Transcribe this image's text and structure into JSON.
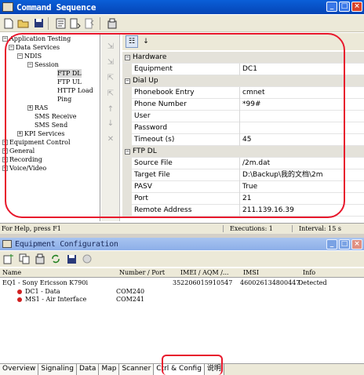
{
  "window": {
    "title": "Command Sequence",
    "minimize_label": "_",
    "maximize_label": "□",
    "close_label": "×"
  },
  "tree": {
    "items": [
      {
        "label": "Application Testing",
        "expander": "−"
      },
      {
        "label": "Data Services",
        "expander": "−"
      },
      {
        "label": "NDIS",
        "expander": "−"
      },
      {
        "label": "Session",
        "expander": "−"
      },
      {
        "label": "FTP DL",
        "expander": ""
      },
      {
        "label": "FTP UL",
        "expander": ""
      },
      {
        "label": "HTTP Load",
        "expander": ""
      },
      {
        "label": "Ping",
        "expander": ""
      },
      {
        "label": "RAS",
        "expander": "+"
      },
      {
        "label": "SMS Receive",
        "expander": ""
      },
      {
        "label": "SMS Send",
        "expander": ""
      },
      {
        "label": "KPI Services",
        "expander": "+"
      },
      {
        "label": "Equipment Control",
        "expander": "+"
      },
      {
        "label": "General",
        "expander": "+"
      },
      {
        "label": "Recording",
        "expander": "+"
      },
      {
        "label": "Voice/Video",
        "expander": "+"
      }
    ]
  },
  "properties": {
    "rows": [
      {
        "kind": "category",
        "label": "Hardware"
      },
      {
        "kind": "prop",
        "key": "Equipment",
        "value": "DC1"
      },
      {
        "kind": "category",
        "label": "Dial Up"
      },
      {
        "kind": "prop",
        "key": "Phonebook Entry",
        "value": "cmnet"
      },
      {
        "kind": "prop",
        "key": "Phone Number",
        "value": "*99#"
      },
      {
        "kind": "prop",
        "key": "User",
        "value": ""
      },
      {
        "kind": "prop",
        "key": "Password",
        "value": ""
      },
      {
        "kind": "prop",
        "key": "Timeout (s)",
        "value": "45"
      },
      {
        "kind": "category",
        "label": "FTP DL"
      },
      {
        "kind": "prop",
        "key": "Source File",
        "value": "/2m.dat"
      },
      {
        "kind": "prop",
        "key": "Target File",
        "value": "D:\\Backup\\我的文档\\2m"
      },
      {
        "kind": "prop",
        "key": "PASV",
        "value": "True"
      },
      {
        "kind": "prop",
        "key": "Port",
        "value": "21"
      },
      {
        "kind": "prop",
        "key": "Remote Address",
        "value": "211.139.16.39"
      }
    ],
    "collapse_glyph": "−"
  },
  "status": {
    "help": "For Help, press F1",
    "executions": "Executions: 1",
    "interval": "Interval: 15 s"
  },
  "equipment_window": {
    "title": "Equipment Configuration",
    "columns": {
      "name": "Name",
      "number_port": "Number / Port",
      "imei": "IMEI / AQM /...",
      "imsi": "IMSI",
      "info": "Info"
    },
    "rows": [
      {
        "name": "EQ1 - Sony Ericsson K790i",
        "port": "",
        "imei": "352206015910547",
        "imsi": "460026134800447",
        "info": "Detected",
        "dot": false
      },
      {
        "name": "DC1 - Data",
        "port": "COM240",
        "imei": "",
        "imsi": "",
        "info": "",
        "dot": true
      },
      {
        "name": "MS1 - Air Interface",
        "port": "COM241",
        "imei": "",
        "imsi": "",
        "info": "",
        "dot": true
      }
    ]
  },
  "bottom_tabs": [
    "Overview",
    "Signaling",
    "Data",
    "Map",
    "Scanner",
    "Ctrl & Config",
    "说明"
  ]
}
